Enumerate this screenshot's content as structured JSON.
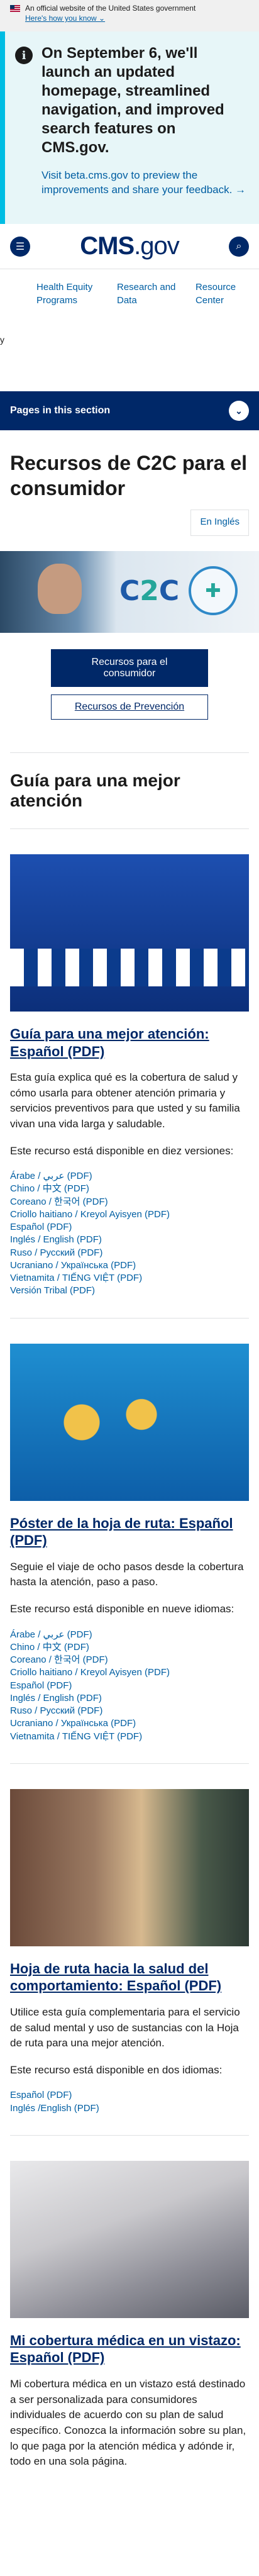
{
  "gov_banner": {
    "text": "An official website of the United States government",
    "how_link": "Here's how you know ⌄"
  },
  "alert": {
    "icon": "info-icon",
    "heading": "On September 6, we'll launch an updated homepage, streamlined navigation, and improved search features on CMS.gov.",
    "link": "Visit beta.cms.gov to preview the improvements and share your feedback. →"
  },
  "header": {
    "logo_main": "CMS",
    "logo_suffix": ".gov",
    "menu_icon": "menu-icon",
    "search_icon": "search-icon"
  },
  "nav": [
    "Health Equity Programs",
    "Research and Data",
    "Resource Center"
  ],
  "stray_mark": "y",
  "pages_bar": {
    "label": "Pages in this section",
    "icon": "chevron-down-icon"
  },
  "page_title": "Recursos de C2C para el consumidor",
  "english_button": "En Inglés",
  "hero": {
    "logo_text": "C2C",
    "badge_icon": "plus-icon"
  },
  "buttons": {
    "primary": "Recursos para el consumidor",
    "secondary": "Recursos de Prevención"
  },
  "section_title": "Guía para una mejor atención",
  "cards": [
    {
      "title": "Guía para una mejor atención: Español (PDF)",
      "desc": "Esta guía explica qué es la cobertura de salud y cómo usarla para obtener atención primaria y servicios preventivos para que usted y su familia vivan una vida larga y saludable.",
      "avail": "Este recurso está disponible en diez versiones:",
      "links": [
        "Árabe / عربي (PDF)",
        "Chino / 中文 (PDF)",
        "Coreano / 한국어 (PDF)",
        "Criollo haitiano / Kreyol Ayisyen (PDF)",
        "Español (PDF)",
        "Inglés / English (PDF)",
        "Ruso / Русский (PDF)",
        "Ucraniano / Українська (PDF)",
        "Vietnamita / TIẾNG VIỆT (PDF)",
        "Versión Tribal (PDF)"
      ]
    },
    {
      "title": "Póster de la hoja de ruta: Español (PDF)",
      "desc": "Seguie el viaje de ocho pasos desde la cobertura hasta la atención, paso a paso.",
      "avail": "Este recurso está disponible en nueve idiomas:",
      "links": [
        "Árabe / عربي (PDF)",
        "Chino / 中文 (PDF)",
        "Coreano / 한국어 (PDF)",
        "Criollo haitiano / Kreyol Ayisyen (PDF)",
        "Español (PDF)",
        "Inglés / English (PDF)",
        "Ruso / Русский (PDF)",
        "Ucraniano / Українська (PDF)",
        "Vietnamita / TIẾNG VIỆT (PDF)"
      ]
    },
    {
      "title": "Hoja de ruta hacia la salud del comportamiento: Español (PDF)",
      "desc": "Utilice esta guía complementaria para el servicio de salud mental y uso de sustancias con la Hoja de ruta para una mejor atención.",
      "avail": "Este recurso está disponible en dos idiomas:",
      "links": [
        "Español (PDF)",
        "Inglés /English (PDF)"
      ]
    },
    {
      "title": "Mi cobertura médica en un vistazo: Español (PDF)",
      "desc": "Mi cobertura médica en un vistazo está destinado a ser personalizada para consumidores individuales de acuerdo con su plan de salud específico. Conozca la información sobre su plan, lo que paga por la atención médica y adónde ir, todo en una sola página.",
      "avail": "",
      "links": []
    }
  ],
  "colors": {
    "navy": "#002868",
    "link": "#005ea2",
    "alert_bg": "#e7f6f8",
    "alert_border": "#00bde3"
  }
}
